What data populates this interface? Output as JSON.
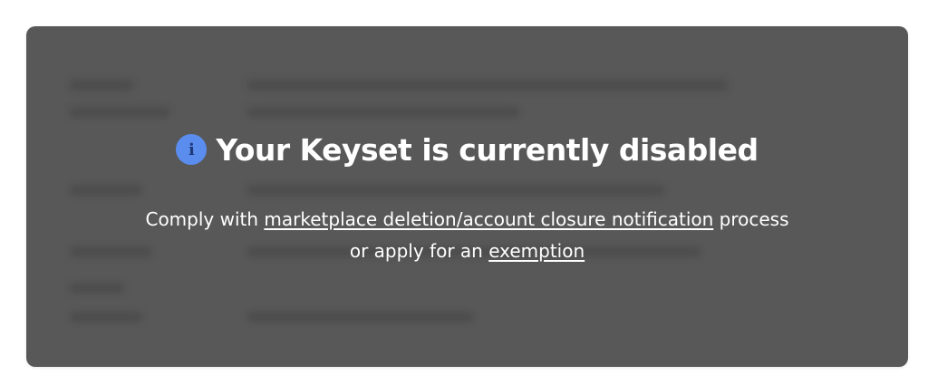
{
  "banner": {
    "title": "Your Keyset is currently disabled",
    "icon": "info-icon",
    "message": {
      "line1_prefix": "Comply with ",
      "line1_link": "marketplace deletion/account closure notification",
      "line1_suffix": " process",
      "line2_prefix": "or apply for an ",
      "line2_link": "exemption"
    }
  },
  "colors": {
    "card_background": "#585858",
    "icon_background": "#5b8dee",
    "text": "#ffffff"
  }
}
